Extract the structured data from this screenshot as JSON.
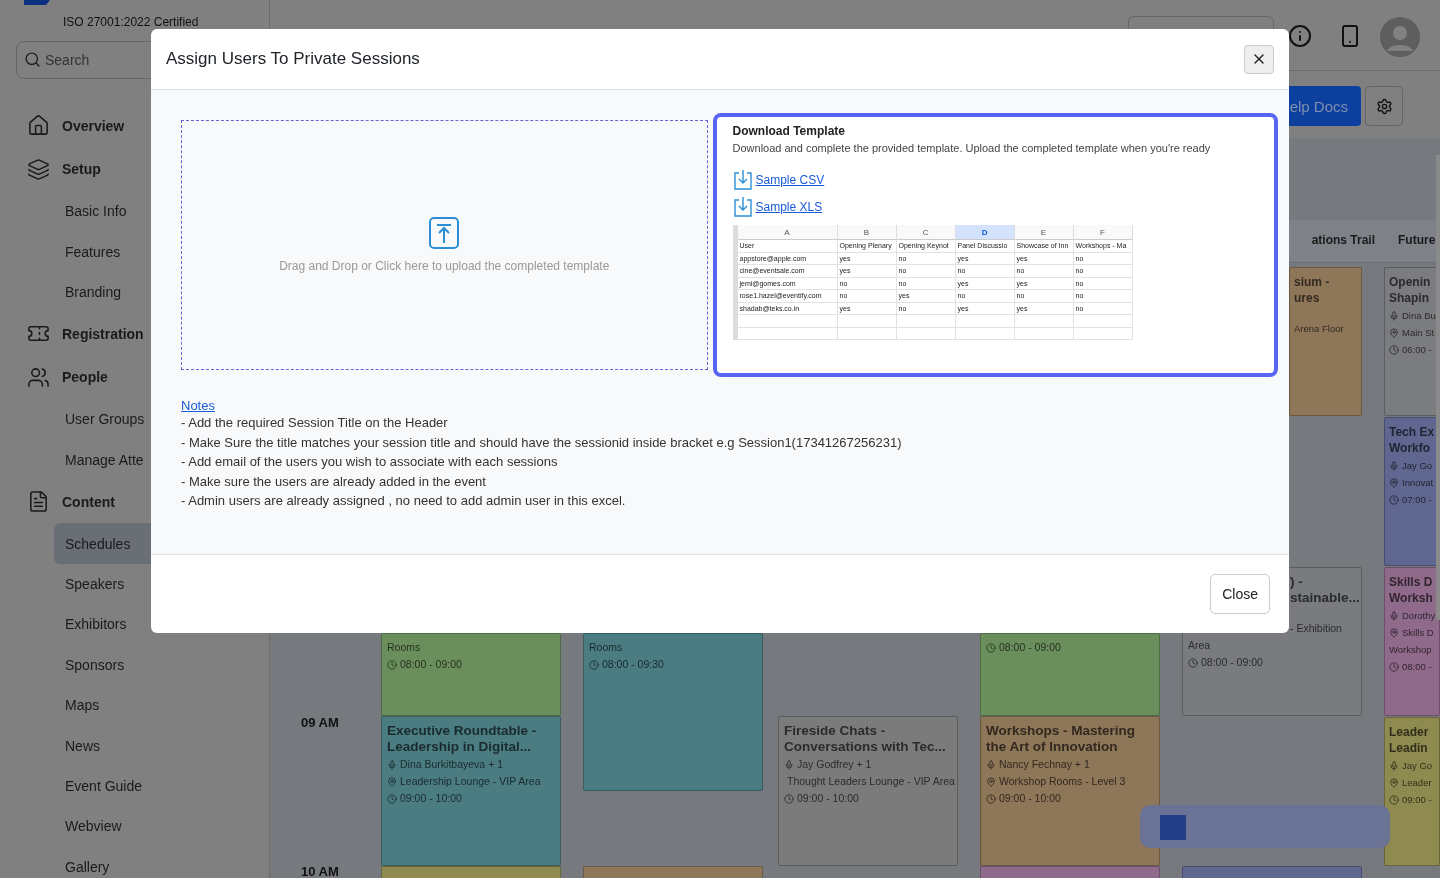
{
  "sidebar": {
    "certification": "ISO 27001:2022 Certified",
    "search": {
      "placeholder": "Search"
    },
    "nav": [
      {
        "label": "Overview",
        "kind": "section",
        "selected": false
      },
      {
        "label": "Setup",
        "kind": "section",
        "selected": false
      },
      {
        "label": "Basic Info",
        "kind": "sub",
        "selected": false
      },
      {
        "label": "Features",
        "kind": "sub",
        "selected": false
      },
      {
        "label": "Branding",
        "kind": "sub",
        "selected": false
      },
      {
        "label": "Registration",
        "kind": "section",
        "selected": false
      },
      {
        "label": "People",
        "kind": "section",
        "selected": false
      },
      {
        "label": "User Groups",
        "kind": "sub",
        "selected": false
      },
      {
        "label": "Manage Atte",
        "kind": "sub",
        "selected": false
      },
      {
        "label": "Content",
        "kind": "section",
        "selected": false
      },
      {
        "label": "Schedules",
        "kind": "sub",
        "selected": true
      },
      {
        "label": "Speakers",
        "kind": "sub",
        "selected": false
      },
      {
        "label": "Exhibitors",
        "kind": "sub",
        "selected": false
      },
      {
        "label": "Sponsors",
        "kind": "sub",
        "selected": false
      },
      {
        "label": "Maps",
        "kind": "sub",
        "selected": false
      },
      {
        "label": "News",
        "kind": "sub",
        "selected": false
      },
      {
        "label": "Event Guide",
        "kind": "sub",
        "selected": false
      },
      {
        "label": "Webview",
        "kind": "sub",
        "selected": false
      },
      {
        "label": "Gallery",
        "kind": "sub",
        "selected": false
      }
    ]
  },
  "toolbar": {
    "help_button": "elp Docs"
  },
  "calendar": {
    "headers": [
      "ations Trail",
      "Future"
    ],
    "time_labels": [
      "09 AM",
      "10 AM"
    ],
    "events": [
      {
        "color": "#8e7659",
        "title": "sium -\nures",
        "lines": [
          {
            "kind": "plain",
            "text": "Arena Floor"
          }
        ]
      },
      {
        "color": "#7a7c7f",
        "title": "Openin\nShapin",
        "lines": [
          {
            "kind": "speaker",
            "text": "Dina Bu"
          },
          {
            "kind": "location",
            "text": "Main St"
          },
          {
            "kind": "time",
            "text": "06:00 -"
          }
        ]
      },
      {
        "color": "#5f6790",
        "title": "Tech Ex\nWorkfo",
        "lines": [
          {
            "kind": "speaker",
            "text": "Jay Go"
          },
          {
            "kind": "location",
            "text": "Innovat"
          },
          {
            "kind": "time",
            "text": "07:00 -"
          }
        ]
      },
      {
        "color": "#6b8f5c",
        "lines": [
          {
            "kind": "plain",
            "text": "Rooms"
          },
          {
            "kind": "time",
            "text": "08:00 - 09:00"
          }
        ]
      },
      {
        "color": "#4b7c82",
        "lines": [
          {
            "kind": "plain",
            "text": "Rooms"
          },
          {
            "kind": "time",
            "text": "08:00 - 09:30"
          }
        ]
      },
      {
        "color": "#6b8f5c",
        "lines": [
          {
            "kind": "time",
            "text": "08:00 - 09:00"
          }
        ]
      },
      {
        "color": "#797b7e",
        "title": ") -\nstainable...",
        "lines": [
          {
            "kind": "plain",
            "text": "- Exhibition"
          },
          {
            "kind": "plain",
            "text": "Area"
          },
          {
            "kind": "time",
            "text": "08:00 - 09:00"
          }
        ]
      },
      {
        "color": "#8f6a8a",
        "title": "Skills D\nWorksh",
        "lines": [
          {
            "kind": "speaker",
            "text": "Dorothy"
          },
          {
            "kind": "location",
            "text": "Skills D"
          },
          {
            "kind": "plain",
            "text": "Workshop"
          },
          {
            "kind": "time",
            "text": "08:00 -"
          }
        ]
      },
      {
        "color": "#4b7c82",
        "title": "Executive Roundtable - Leadership in Digital...",
        "lines": [
          {
            "kind": "speaker",
            "text": "Dina Burkitbayeva + 1"
          },
          {
            "kind": "location",
            "text": "Leadership Lounge - VIP Area"
          },
          {
            "kind": "time",
            "text": "09:00 - 10:00"
          }
        ]
      },
      {
        "color": "#7b7b7b",
        "title": "Fireside Chats - Conversations with Tec...",
        "lines": [
          {
            "kind": "speaker",
            "text": "Jay Godfrey + 1"
          },
          {
            "kind": "location",
            "text": "Thought Leaders Lounge - VIP Area"
          },
          {
            "kind": "time",
            "text": "09:00 - 10:00"
          }
        ]
      },
      {
        "color": "#8e7659",
        "title": "Workshops - Mastering the Art of Innovation",
        "lines": [
          {
            "kind": "speaker",
            "text": "Nancy Fechnay + 1"
          },
          {
            "kind": "location",
            "text": "Workshop Rooms - Level 3"
          },
          {
            "kind": "time",
            "text": "09:00 - 10:00"
          }
        ]
      },
      {
        "color": "#8f8a4f",
        "title": "Leader\nLeadin",
        "lines": [
          {
            "kind": "speaker",
            "text": "Jay Go"
          },
          {
            "kind": "location",
            "text": "Leader"
          },
          {
            "kind": "time",
            "text": "09:00 -"
          }
        ]
      },
      {
        "color": "#8f8a4f"
      },
      {
        "color": "#8e7659"
      },
      {
        "color": "#8f6a8a"
      },
      {
        "color": "#5f6790"
      }
    ]
  },
  "modal": {
    "title": "Assign Users To Private Sessions",
    "dropzone": {
      "text": "Drag and Drop or Click here to upload the completed template"
    },
    "template": {
      "title": "Download Template",
      "description": "Download and complete the provided template. Upload the completed template when you're ready",
      "links": [
        "Sample CSV",
        "Sample XLS"
      ],
      "sheet": {
        "columns": [
          {
            "label": "A",
            "selected": false
          },
          {
            "label": "B",
            "selected": false
          },
          {
            "label": "C",
            "selected": false
          },
          {
            "label": "D",
            "selected": true
          },
          {
            "label": "E",
            "selected": false
          },
          {
            "label": "F",
            "selected": false
          }
        ],
        "rows": [
          [
            "User",
            "Opening Plenary",
            "Opening Keynot",
            "Panel Discussio",
            "Showcase of Inn",
            "Workshops - Ma"
          ],
          [
            "appstore@apple.com",
            "yes",
            "no",
            "yes",
            "yes",
            "no"
          ],
          [
            "cine@eventsale.com",
            "yes",
            "no",
            "no",
            "no",
            "no"
          ],
          [
            "jemi@gomes.com",
            "no",
            "no",
            "yes",
            "yes",
            "no"
          ],
          [
            "rose1.hazel@eventify.com",
            "no",
            "yes",
            "no",
            "no",
            "no"
          ],
          [
            "shadab@teks.co.in",
            "yes",
            "no",
            "yes",
            "yes",
            "no"
          ]
        ]
      }
    },
    "notes": {
      "link": "Notes",
      "lines": [
        "- Add the required Session Title on the Header",
        "- Make Sure the title matches your session title and should have the sessionid inside bracket e.g Session1(17341267256231)",
        "- Add email of the users you wish to associate with each sessions",
        "- Make sure the users are already added in the event",
        "- Admin users are already assigned , no need to add admin user in this excel."
      ]
    },
    "close_button": "Close"
  }
}
